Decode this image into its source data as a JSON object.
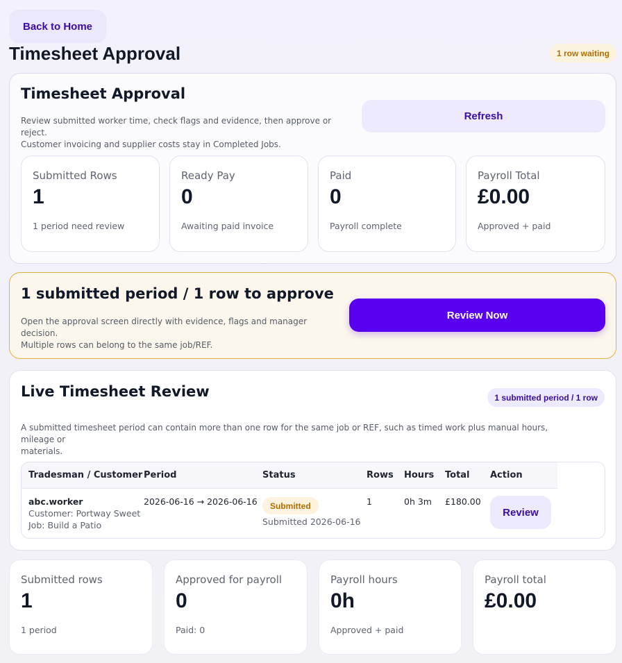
{
  "nav": {
    "back_label": "Back to Home"
  },
  "header": {
    "title": "Timesheet Approval",
    "waiting_badge": "1 row waiting"
  },
  "approval": {
    "title": "Timesheet Approval",
    "description_line1": "Review submitted worker time, check flags and evidence, then approve or reject.",
    "description_line2": "Customer invoicing and supplier costs stay in Completed Jobs.",
    "refresh_label": "Refresh",
    "stats": [
      {
        "label": "Submitted Rows",
        "value": "1",
        "sub": "1 period need review"
      },
      {
        "label": "Ready Pay",
        "value": "0",
        "sub": "Awaiting paid invoice"
      },
      {
        "label": "Paid",
        "value": "0",
        "sub": "Payroll complete"
      },
      {
        "label": "Payroll Total",
        "value": "£0.00",
        "sub": "Approved + paid"
      }
    ]
  },
  "alert": {
    "title": "1 submitted period / 1 row to approve",
    "description_line1": "Open the approval screen directly with evidence, flags and manager decision.",
    "description_line2": "Multiple rows can belong to the same job/REF.",
    "button_label": "Review Now"
  },
  "live_review": {
    "title": "Live Timesheet Review",
    "badge": "1 submitted period / 1 row",
    "description_line1": "A submitted timesheet period can contain more than one row for the same job or REF, such as timed work plus manual hours, mileage or",
    "description_line2": "materials.",
    "columns": [
      "Tradesman / Customer",
      "Period",
      "Status",
      "Rows",
      "Hours",
      "Total",
      "Action"
    ],
    "rows": [
      {
        "worker": "abc.worker",
        "customer": "Customer: Portway Sweet",
        "job": "Job: Build a Patio",
        "period": "2026-06-16 → 2026-06-16",
        "status": "Submitted",
        "submitted_on": "Submitted 2026-06-16",
        "rows": "1",
        "hours": "0h 3m",
        "total": "£180.00",
        "action": "Review"
      }
    ]
  },
  "summary": [
    {
      "label": "Submitted rows",
      "value": "1",
      "sub": "1 period"
    },
    {
      "label": "Approved for payroll",
      "value": "0",
      "sub": "Paid: 0"
    },
    {
      "label": "Payroll hours",
      "value": "0h",
      "sub": "Approved + paid"
    },
    {
      "label": "Payroll total",
      "value": "£0.00",
      "sub": ""
    }
  ],
  "colors": {
    "accent": "#5a00f0",
    "accent_text": "#3a0ca3",
    "warning_bg": "#fcf7ec",
    "warning_border": "#e3b23c",
    "warning_text": "#b16d00"
  }
}
